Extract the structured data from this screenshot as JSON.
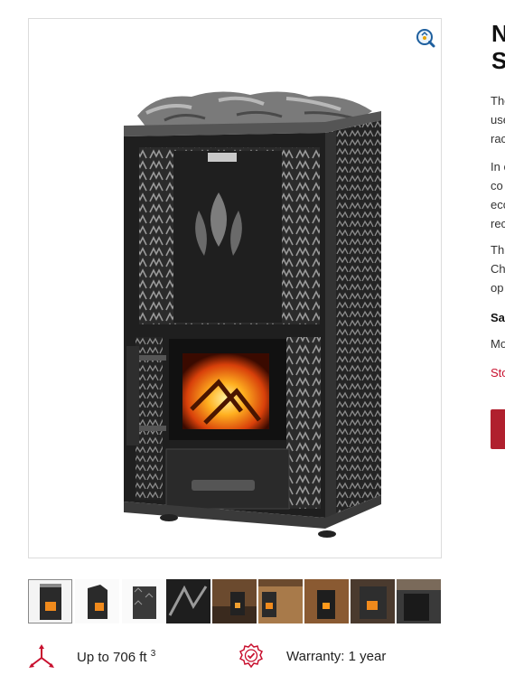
{
  "product": {
    "title_lines": [
      "N",
      "S"
    ],
    "description_lines": [
      "The",
      "use",
      "rac",
      "In c",
      "co",
      "ecc",
      "rec",
      "Thi",
      "Ch",
      "op"
    ],
    "spec_label": "Sa",
    "spec_value": "Mo",
    "stock_text": "Sto",
    "accent_color": "#c8102e"
  },
  "gallery": {
    "zoom_icon": "zoom-in-icon",
    "thumbnails": [
      {
        "name": "stove-front-thumb",
        "active": true
      },
      {
        "name": "stove-side-thumb",
        "active": false
      },
      {
        "name": "stove-panel-thumb",
        "active": false
      },
      {
        "name": "stove-detail-thumb",
        "active": false
      },
      {
        "name": "sauna-room-thumb-1",
        "active": false
      },
      {
        "name": "sauna-room-thumb-2",
        "active": false
      },
      {
        "name": "sauna-room-thumb-3",
        "active": false
      },
      {
        "name": "sauna-room-thumb-4",
        "active": false
      },
      {
        "name": "sauna-room-thumb-5",
        "active": false
      }
    ]
  },
  "features": {
    "volume_text": "Up to 706 ft",
    "volume_unit_exp": "3",
    "volume_icon": "room-volume-icon",
    "warranty_text": "Warranty: 1 year",
    "warranty_icon": "warranty-seal-icon"
  }
}
